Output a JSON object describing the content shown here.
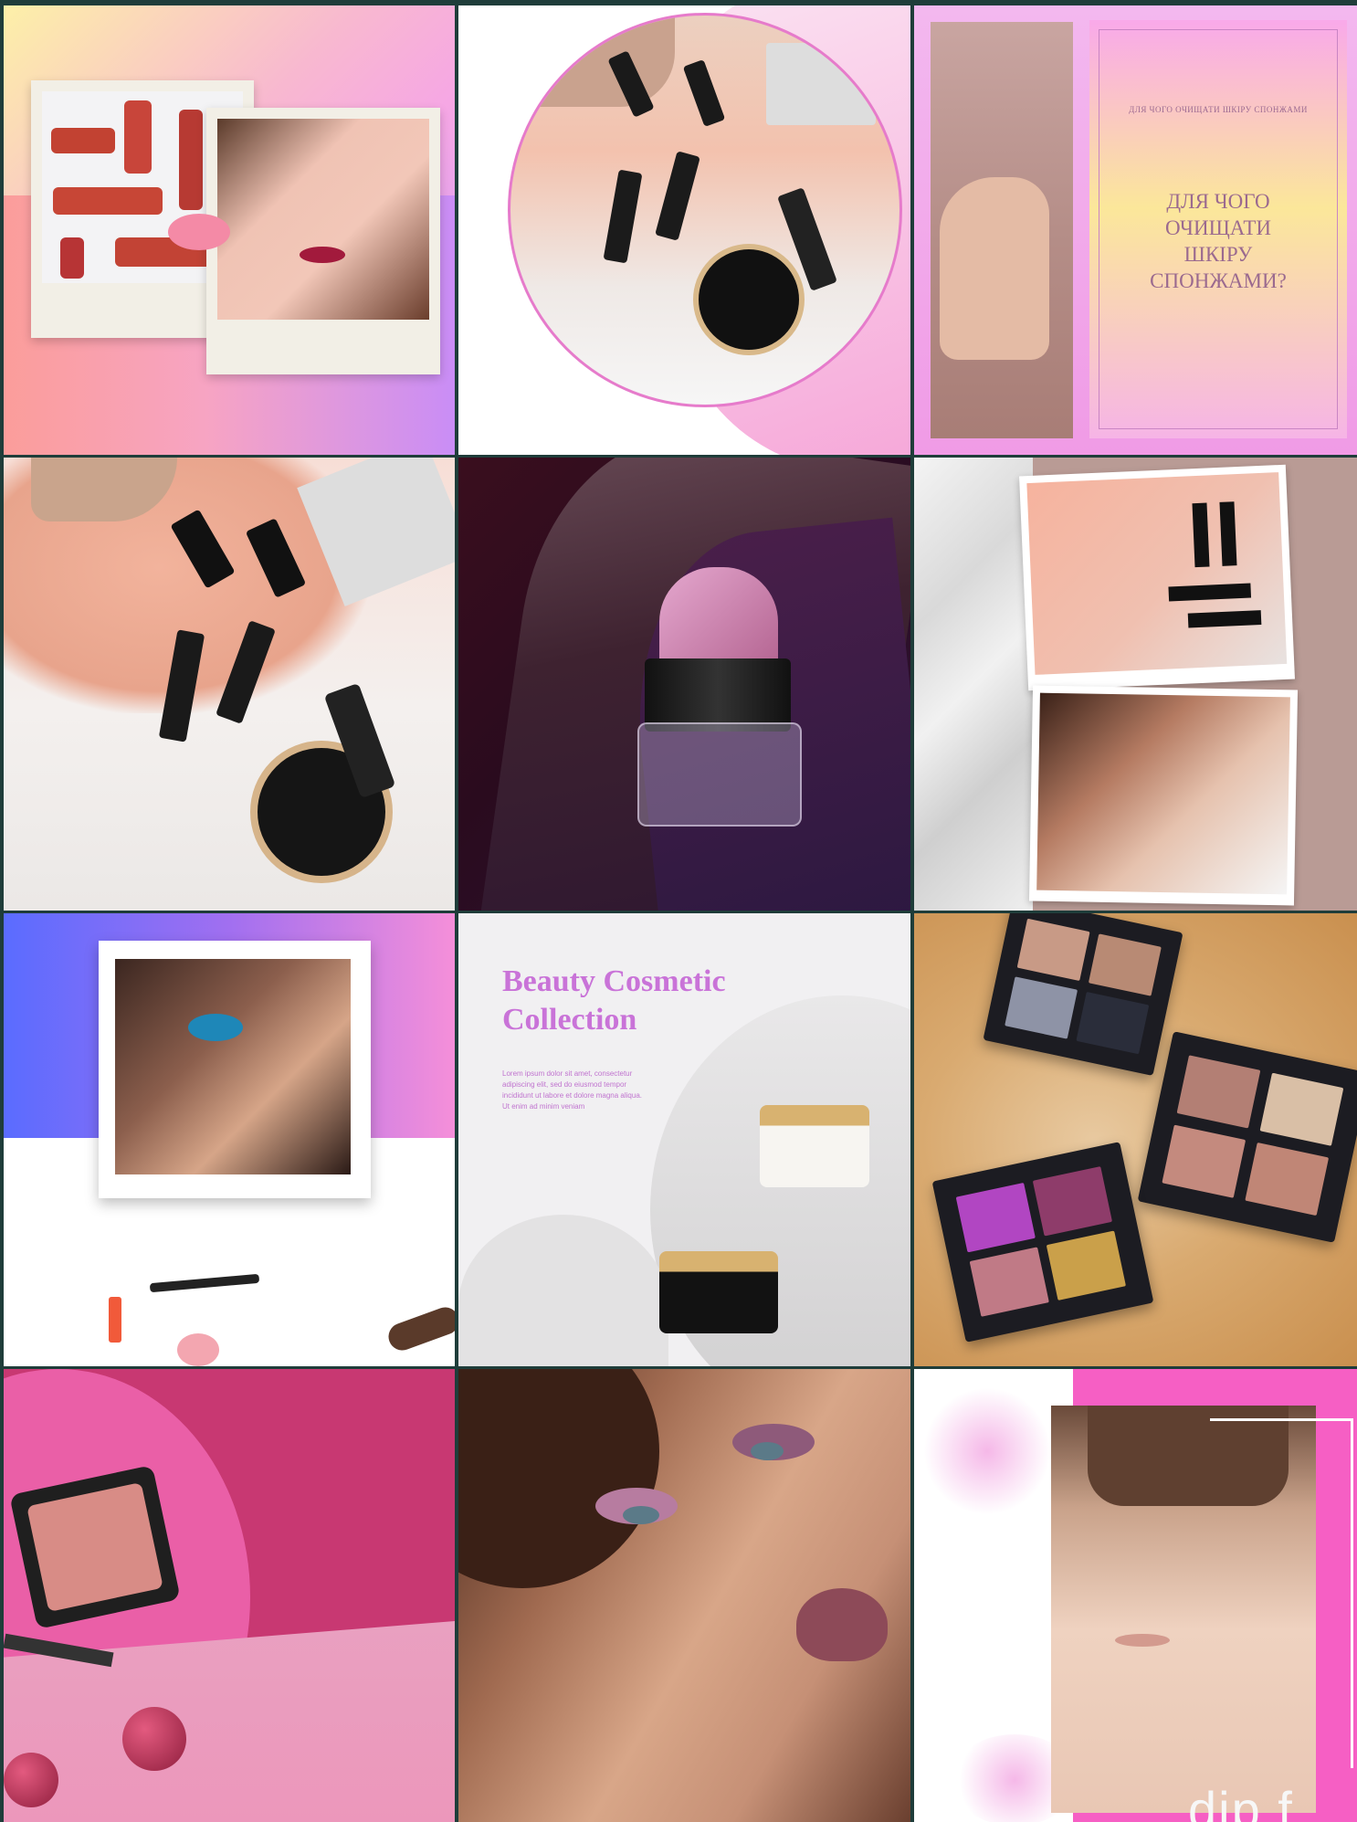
{
  "feed": {
    "tile3": {
      "small_text": "ДЛЯ ЧОГО ОЧИЩАТИ ШКІРУ СПОНЖАМИ",
      "big_text": "ДЛЯ ЧОГО\nОЧИЩАТИ\nШКІРУ\nСПОНЖАМИ?"
    },
    "tile8": {
      "title": "Beauty Cosmetic Collection",
      "body": "Lorem ipsum dolor sit amet, consectetur adipiscing elit, sed do eiusmod tempor incididunt ut labore et dolore magna aliqua. Ut enim ad minim veniam"
    },
    "tile12": {
      "overlay_text": "dip f"
    }
  },
  "colors": {
    "background": "#1f3d3a",
    "accent_pink": "#f65fc4",
    "title_purple": "#c973d8"
  }
}
